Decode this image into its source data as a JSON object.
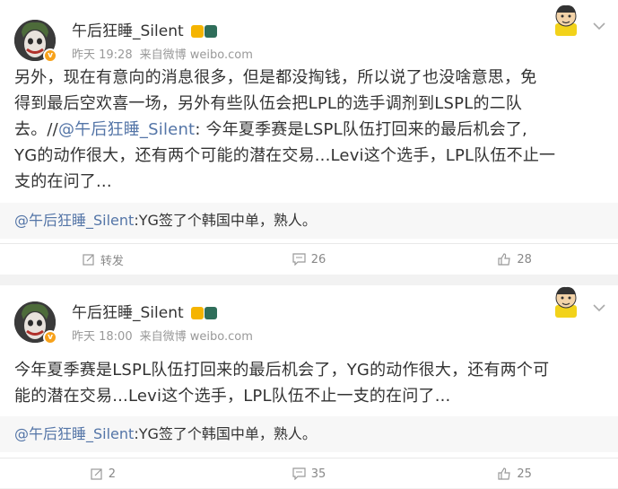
{
  "posts": [
    {
      "user": {
        "name": "午后狂睡_Silent"
      },
      "time": "昨天 19:28",
      "source": "来自微博 weibo.com",
      "text_lines": [
        "另外，现在有意向的消息很多，但是都没掏钱，所以说了也没啥意思，免",
        "得到最后空欢喜一场，另外有些队伍会把LPL的选手调剂到LSPL的二队",
        "YG的动作很大，还有两个可能的潜在交易...Levi这个选手，LPL队伍不止一",
        "支的在问了..."
      ],
      "line3_prefix": "去。//",
      "line3_mention": "@午后狂睡_Silent",
      "line3_suffix": ": 今年夏季赛是LSPL队伍打回来的最后机会了,",
      "quote_mention": "@午后狂睡_Silent",
      "quote_text": ":YG签了个韩国中单，熟人。",
      "actions": {
        "repost": "转发",
        "comments": "26",
        "likes": "28"
      }
    },
    {
      "user": {
        "name": "午后狂睡_Silent"
      },
      "time": "昨天 18:00",
      "source": "来自微博 weibo.com",
      "text_lines": [
        "今年夏季赛是LSPL队伍打回来的最后机会了，YG的动作很大，还有两个可",
        "能的潜在交易...Levi这个选手，LPL队伍不止一支的在问了..."
      ],
      "quote_mention": "@午后狂睡_Silent",
      "quote_text": ":YG签了个韩国中单，熟人。",
      "actions": {
        "reposts": "2",
        "comments": "35",
        "likes": "25"
      }
    }
  ],
  "colors": {
    "mention": "#5475a7",
    "meta": "#999999",
    "badge": "#f7a21b"
  }
}
